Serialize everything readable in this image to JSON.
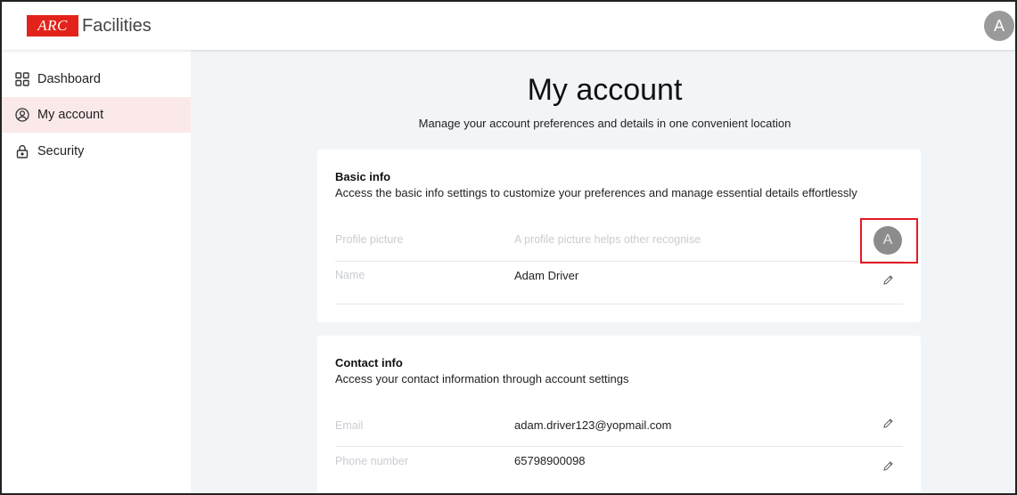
{
  "header": {
    "logo_mark": "ARC",
    "logo_text": "Facilities",
    "avatar_initial": "A"
  },
  "sidebar": {
    "items": [
      {
        "label": "Dashboard",
        "icon": "grid-icon"
      },
      {
        "label": "My account",
        "icon": "user-circle-icon",
        "active": true
      },
      {
        "label": "Security",
        "icon": "lock-icon"
      }
    ]
  },
  "main": {
    "title": "My account",
    "subtitle": "Manage your account preferences and details in one convenient location"
  },
  "basic_info": {
    "title": "Basic info",
    "description": "Access the basic info settings to customize your preferences and manage essential details effortlessly",
    "profile_picture_label": "Profile picture",
    "profile_picture_hint": "A profile picture helps other recognise",
    "avatar_initial": "A",
    "name_label": "Name",
    "name_value": "Adam Driver"
  },
  "contact_info": {
    "title": "Contact info",
    "description": "Access your contact information through account settings",
    "email_label": "Email",
    "email_value": "adam.driver123@yopmail.com",
    "phone_label": "Phone number",
    "phone_value": "65798900098"
  },
  "colors": {
    "brand": "#e2231a",
    "active_nav_bg": "#fbe9e9",
    "page_bg": "#f2f5f8",
    "highlight": "#e31b23"
  }
}
